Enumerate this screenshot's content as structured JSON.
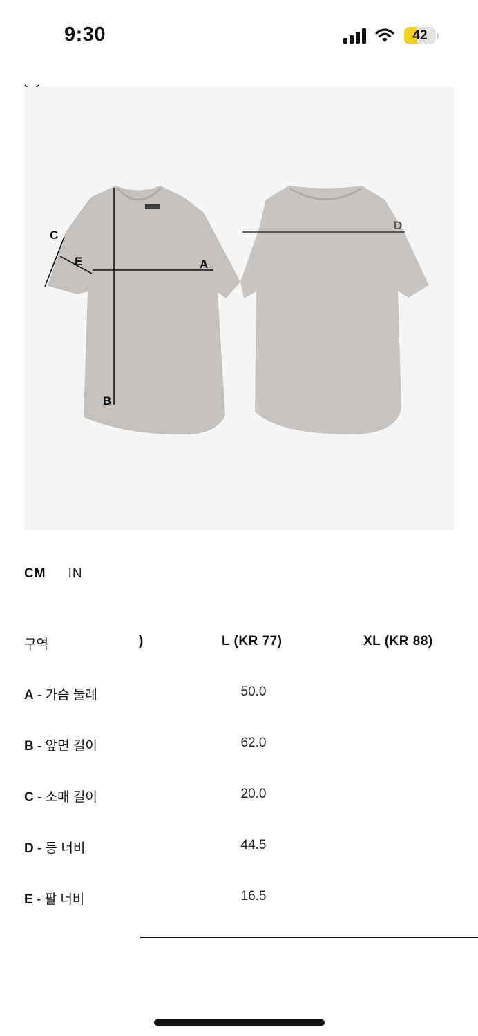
{
  "status_bar": {
    "time": "9:30",
    "battery_level": "42",
    "icons": [
      "signal-icon",
      "wifi-icon",
      "battery-icon"
    ]
  },
  "close_button": {
    "icon": "close-icon"
  },
  "diagram": {
    "labels": {
      "a": "A",
      "b": "B",
      "c": "C",
      "d": "D",
      "e": "E"
    },
    "garment_color": "#c4c1bf",
    "background_color": "#f5f5f5"
  },
  "units": {
    "cm": "CM",
    "in": "IN",
    "selected": "CM"
  },
  "table": {
    "header_label": "구역",
    "clipped_prev_column": ")",
    "columns": [
      "L (KR 77)",
      "XL (KR 88)"
    ],
    "rows": [
      {
        "code": "A",
        "name": " - 가슴 둘레",
        "value": "50.0"
      },
      {
        "code": "B",
        "name": " - 앞면 길이",
        "value": "62.0"
      },
      {
        "code": "C",
        "name": " - 소매 길이",
        "value": "20.0"
      },
      {
        "code": "D",
        "name": " - 등 너비",
        "value": "44.5"
      },
      {
        "code": "E",
        "name": " - 팔 너비",
        "value": "16.5"
      }
    ]
  }
}
